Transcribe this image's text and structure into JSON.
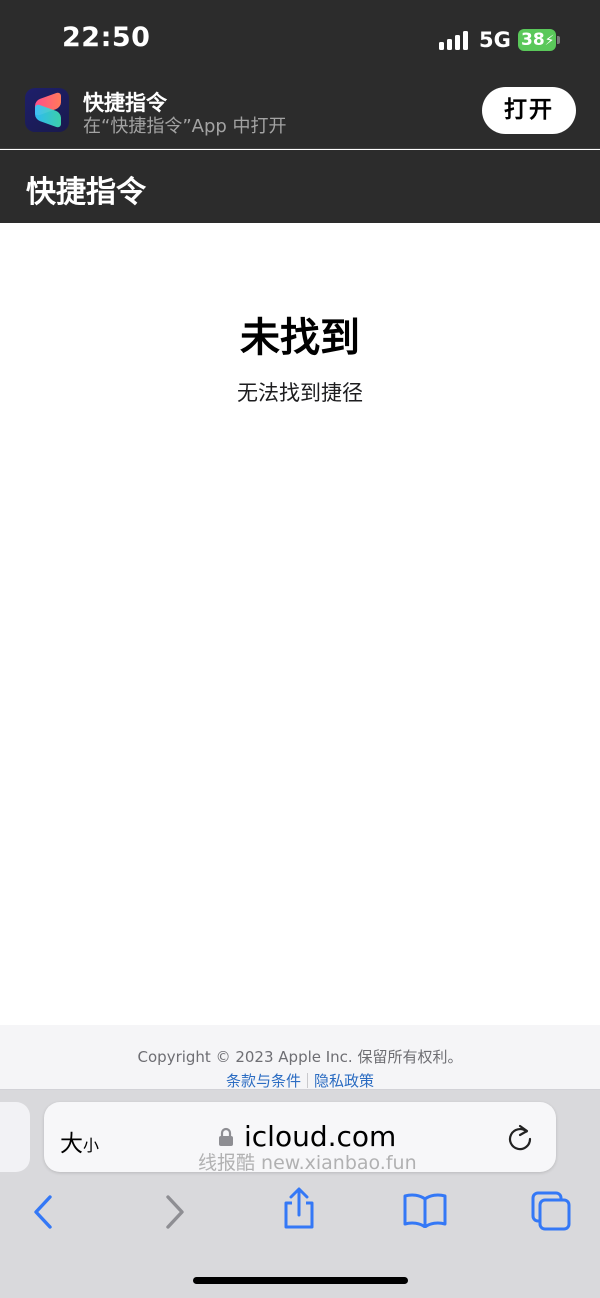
{
  "status_bar": {
    "time": "22:50",
    "network": "5G",
    "battery": "38"
  },
  "app_banner": {
    "name": "快捷指令",
    "subtitle": "在“快捷指令”App 中打开",
    "open_label": "打开"
  },
  "header": {
    "title": "快捷指令"
  },
  "main": {
    "title": "未找到",
    "message": "无法找到捷径"
  },
  "footer": {
    "copyright": "Copyright © 2023 Apple Inc. 保留所有权利。",
    "terms_link": "条款与条件",
    "privacy_link": "隐私政策"
  },
  "address_bar": {
    "aa_big": "大",
    "aa_small": "小",
    "url": "icloud.com",
    "watermark": "线报酷 new.xianbao.fun"
  },
  "toolbar": {
    "icons": [
      "back-icon",
      "forward-icon",
      "share-icon",
      "bookmarks-icon",
      "tabs-icon"
    ],
    "accent_color": "#3478f6",
    "disabled_color": "#8e8e93"
  }
}
